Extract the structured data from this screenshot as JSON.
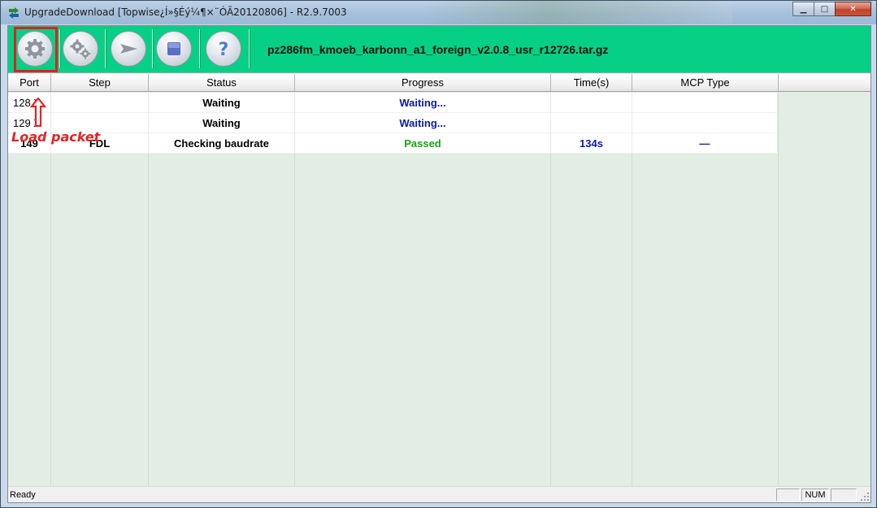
{
  "window": {
    "title": "UpgradeDownload [Topwise¿Í»§Éý¼¶×¨ÓÃ20120806] - R2.9.7003",
    "minimize_glyph": "▁",
    "maximize_glyph": "□",
    "close_glyph": "✕"
  },
  "toolbar": {
    "buttons": [
      {
        "name": "load-packet-button",
        "icon": "gear-icon"
      },
      {
        "name": "settings-button",
        "icon": "gears-icon"
      },
      {
        "name": "start-button",
        "icon": "play-arrow-icon"
      },
      {
        "name": "stop-button",
        "icon": "stop-icon"
      },
      {
        "name": "help-button",
        "icon": "question-icon"
      }
    ],
    "packet_file": "pz286fm_kmoeb_karbonn_a1_foreign_v2.0.8_usr_r12726.tar.gz"
  },
  "annotation": {
    "label": "Load packet",
    "color": "#e02424"
  },
  "table": {
    "columns": [
      "Port",
      "Step",
      "Status",
      "Progress",
      "Time(s)",
      "MCP Type"
    ],
    "rows": [
      {
        "port": "128 X",
        "step": "",
        "status": "Waiting",
        "progress": "Waiting...",
        "time": "",
        "mcp": ""
      },
      {
        "port": "129 X",
        "step": "",
        "status": "Waiting",
        "progress": "Waiting...",
        "time": "",
        "mcp": ""
      },
      {
        "port": "149",
        "step": "FDL",
        "status": "Checking baudrate",
        "progress": "Passed",
        "time": "134s",
        "mcp": "—"
      }
    ]
  },
  "statusbar": {
    "text": "Ready",
    "num": "NUM"
  },
  "colors": {
    "toolbar_bg": "#06d085",
    "progress_waiting": "#0a1aa0",
    "progress_passed": "#17a315",
    "table_bg": "#e2ede4"
  }
}
